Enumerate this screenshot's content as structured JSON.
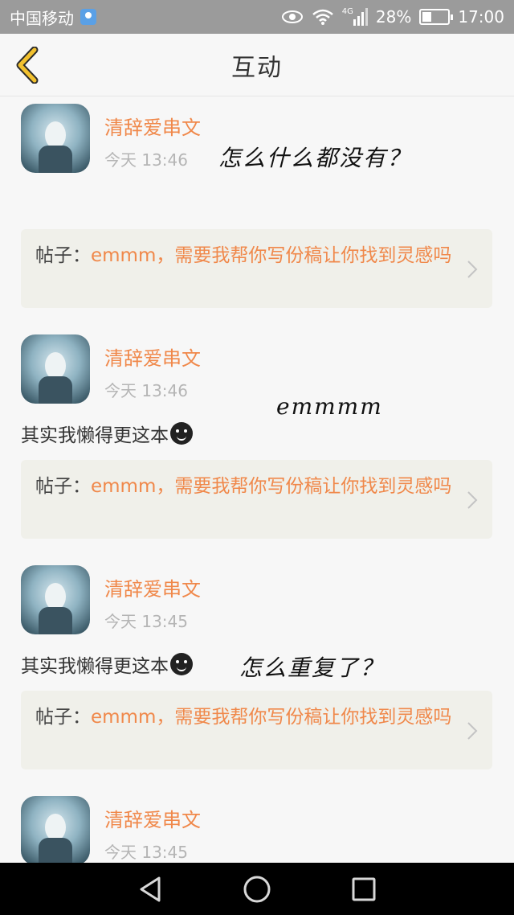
{
  "status_bar": {
    "carrier": "中国移动",
    "network": "4G",
    "battery": "28%",
    "time": "17:00"
  },
  "header": {
    "title": "互动",
    "back_icon": "chevron-left-icon"
  },
  "items": [
    {
      "username": "清辞爱串文",
      "time": "今天 13:46",
      "comment": "",
      "post_label": "帖子：",
      "post_text": "emmm，需要我帮你写份稿让你找到灵感吗"
    },
    {
      "username": "清辞爱串文",
      "time": "今天 13:46",
      "comment": "其实我懒得更这本",
      "post_label": "帖子：",
      "post_text": "emmm，需要我帮你写份稿让你找到灵感吗"
    },
    {
      "username": "清辞爱串文",
      "time": "今天 13:45",
      "comment": "其实我懒得更这本",
      "post_label": "帖子：",
      "post_text": "emmm，需要我帮你写份稿让你找到灵感吗"
    },
    {
      "username": "清辞爱串文",
      "time": "今天 13:45"
    }
  ],
  "annotations": {
    "note1": "怎么什么都没有？",
    "note2": "emmmm",
    "note3": "怎么重复了？"
  },
  "colors": {
    "accent": "#f0884a",
    "back_arrow": "#f2c12e",
    "status_bar": "#9b9b9b"
  }
}
